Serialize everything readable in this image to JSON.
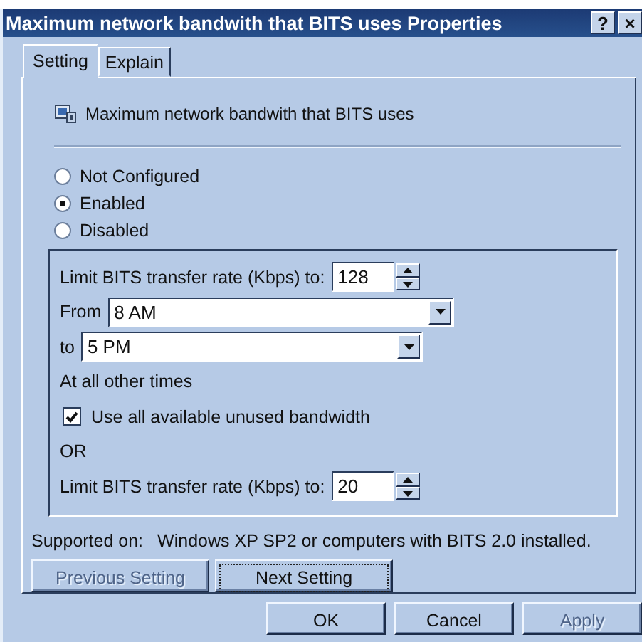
{
  "window": {
    "title": "Maximum network bandwith that BITS uses Properties",
    "title_buttons": [
      "?",
      "×"
    ]
  },
  "tabs": [
    {
      "label": "Setting",
      "selected": true
    },
    {
      "label": "Explain",
      "selected": false
    }
  ],
  "policy": {
    "name": "Maximum network bandwith that BITS uses"
  },
  "options": [
    {
      "label": "Not Configured",
      "selected": false
    },
    {
      "label": "Enabled",
      "selected": true
    },
    {
      "label": "Disabled",
      "selected": false
    }
  ],
  "group": [
    {
      "kind": "spin",
      "label": "Limit BITS transfer rate (Kbps) to:",
      "value": "128"
    },
    {
      "kind": "combo",
      "label": "From",
      "value": "8 AM"
    },
    {
      "kind": "combo",
      "label": "to",
      "value": "5 PM"
    },
    {
      "kind": "text",
      "text": "At all other times"
    },
    {
      "kind": "checkbox",
      "label": "Use all available unused bandwidth",
      "checked": true
    },
    {
      "kind": "text",
      "text": "OR"
    },
    {
      "kind": "spin",
      "label": "Limit BITS transfer rate (Kbps) to:",
      "value": "20"
    }
  ],
  "supported": {
    "label": "Supported on:",
    "value": "Windows XP SP2 or computers with BITS 2.0 installed."
  },
  "nav_buttons": [
    {
      "label": "Previous Setting",
      "disabled": true,
      "focused": false
    },
    {
      "label": "Next Setting",
      "disabled": false,
      "focused": true
    }
  ],
  "buttons": [
    {
      "label": "OK",
      "disabled": false
    },
    {
      "label": "Cancel",
      "disabled": false
    },
    {
      "label": "Apply",
      "disabled": true
    }
  ]
}
